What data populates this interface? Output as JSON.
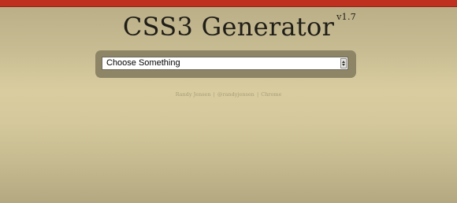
{
  "header": {
    "title": "CSS3 Generator",
    "version": "v1.7"
  },
  "selector": {
    "selected_value": "Choose Something"
  },
  "footer": {
    "author_link": "Randy Jensen",
    "twitter_link": "@randyjensen",
    "browser_link": "Chrome",
    "separator": "|"
  },
  "colors": {
    "top_bar": "#c0301e",
    "panel": "#8e8566",
    "title_text": "#1f1d17",
    "footer_text": "#a89c79"
  },
  "icons": {
    "select_arrow": "select-arrow-icon"
  }
}
